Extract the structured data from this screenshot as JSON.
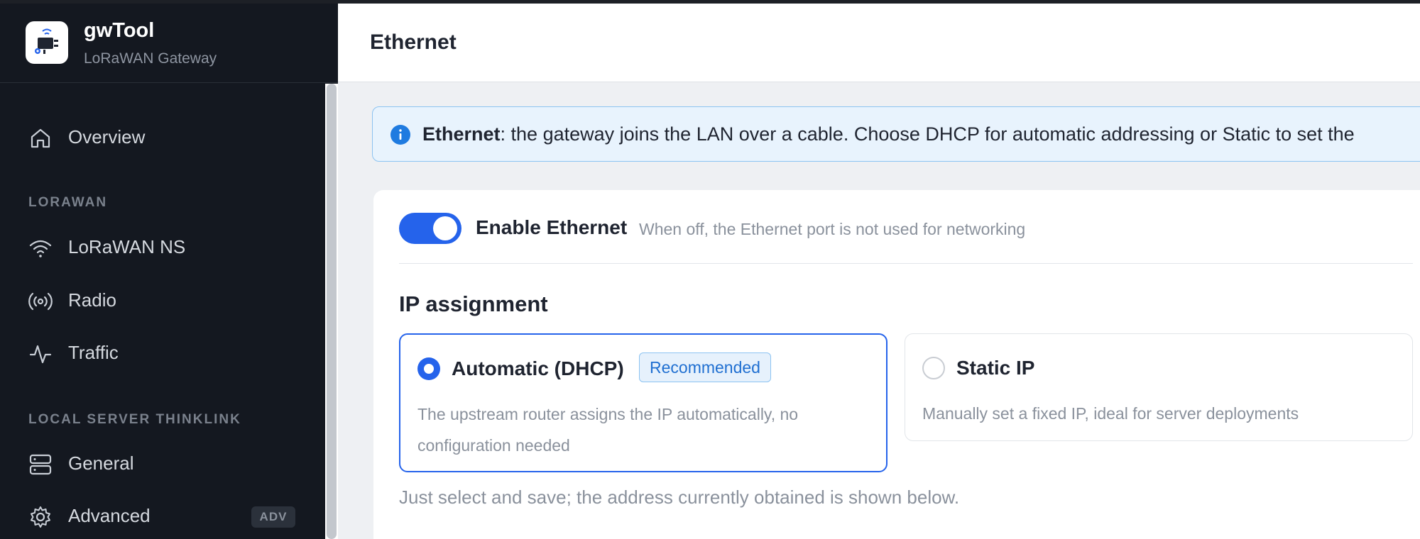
{
  "brand": {
    "name": "gwTool",
    "subtitle": "LoRaWAN Gateway"
  },
  "sidebar": {
    "overview": {
      "label": "Overview",
      "icon": "home-icon"
    },
    "sections": [
      {
        "title": "LORAWAN",
        "items": [
          {
            "label": "LoRaWAN NS",
            "icon": "wifi-icon"
          },
          {
            "label": "Radio",
            "icon": "radio-broadcast-icon"
          },
          {
            "label": "Traffic",
            "icon": "activity-icon"
          }
        ]
      },
      {
        "title": "LOCAL SERVER THINKLINK",
        "items": [
          {
            "label": "General",
            "icon": "server-icon"
          },
          {
            "label": "Advanced",
            "icon": "gear-icon",
            "badge": "ADV"
          }
        ]
      }
    ]
  },
  "header": {
    "title": "Ethernet"
  },
  "info": {
    "bold": "Ethernet",
    "text": ": the gateway joins the LAN over a cable. Choose DHCP for automatic addressing or Static to set the"
  },
  "ethernet": {
    "enable_label": "Enable Ethernet",
    "enable_hint": "When off, the Ethernet port is not used for networking",
    "enabled": true
  },
  "ip_assignment": {
    "title": "IP assignment",
    "options": [
      {
        "title": "Automatic (DHCP)",
        "badge": "Recommended",
        "desc": "The upstream router assigns the IP automatically, no configuration needed",
        "selected": true
      },
      {
        "title": "Static IP",
        "desc": "Manually set a fixed IP, ideal for server deployments",
        "selected": false
      }
    ],
    "footnote": "Just select and save; the address currently obtained is shown below."
  },
  "colors": {
    "accent": "#2563eb",
    "sidebar_bg": "#141820",
    "info_bg": "#e8f3fd"
  }
}
